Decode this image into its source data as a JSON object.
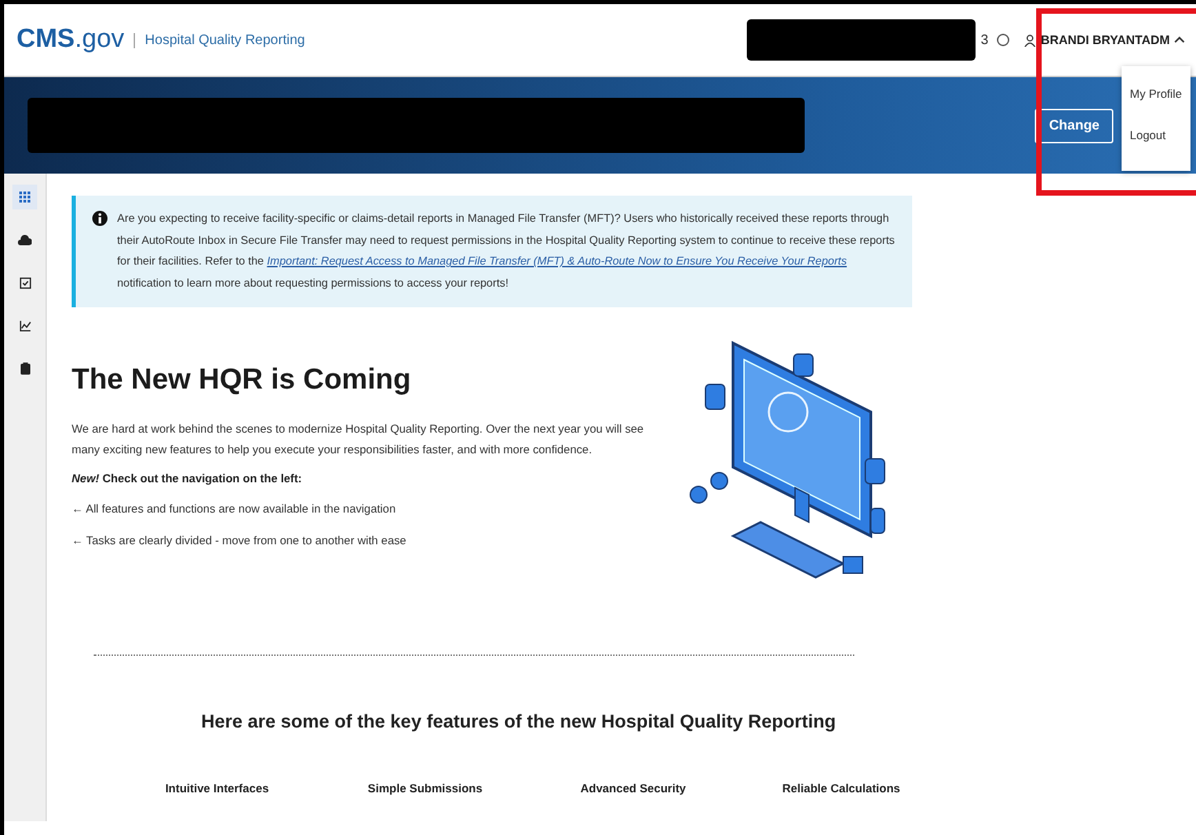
{
  "header": {
    "logo_main": "CMS",
    "logo_suffix": ".gov",
    "product": "Hospital Quality Reporting",
    "count": "3",
    "user": "BRANDI BRYANTADM",
    "user_menu": {
      "expanded": true,
      "items": [
        "My Profile",
        "Logout"
      ]
    }
  },
  "banner": {
    "button": "Change"
  },
  "sidebar": {
    "items": [
      {
        "kind": "grid",
        "selected": true
      },
      {
        "kind": "cloud",
        "selected": false
      },
      {
        "kind": "checklist",
        "selected": false
      },
      {
        "kind": "chart",
        "selected": false
      },
      {
        "kind": "clipboard",
        "selected": false
      }
    ]
  },
  "alert": {
    "text_before": "Are you expecting to receive facility-specific or claims-detail reports in Managed File Transfer (MFT)? Users who historically received these reports through their AutoRoute Inbox in Secure File Transfer may need to request permissions in the Hospital Quality Reporting system to continue to receive these reports for their facilities. Refer to the ",
    "link": "Important: Request Access to Managed File Transfer (MFT) & Auto-Route Now to Ensure You Receive Your Reports",
    "text_after": " notification to learn more about requesting permissions to access your reports!"
  },
  "hero": {
    "title": "The New HQR is Coming",
    "paragraph": "We are hard at work behind the scenes to modernize Hospital Quality Reporting. Over the next year you will see many exciting new features to help you execute your responsibilities faster, and with more confidence.",
    "callout": "*New!* Check out the navigation on the left:",
    "bullets": [
      "← All features and functions are now available in the navigation",
      "← Tasks are clearly divided - move from one to another with ease"
    ]
  },
  "features": {
    "heading": "Here are some of the key features of the new Hospital Quality Reporting",
    "items": [
      "Intuitive Interfaces",
      "Simple Submissions",
      "Advanced Security",
      "Reliable Calculations"
    ]
  }
}
